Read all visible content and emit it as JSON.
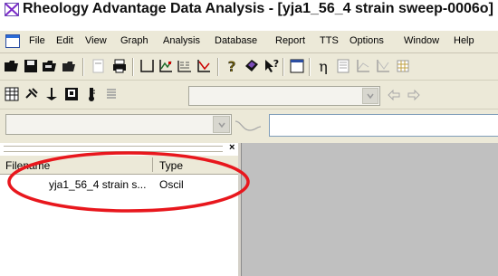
{
  "window": {
    "title": "Rheology Advantage Data Analysis - [yja1_56_4 strain sweep-0006o]"
  },
  "menu": {
    "items": [
      "File",
      "Edit",
      "View",
      "Graph",
      "Analysis",
      "Database",
      "Report",
      "TTS",
      "Options",
      "Window",
      "Help"
    ]
  },
  "toolbar1": {
    "icons": [
      "open-folder-icon",
      "save-icon",
      "open-data-icon",
      "open-file-icon",
      "copy-graph-icon",
      "print-icon",
      "blank-graph-icon",
      "graph-icon",
      "tts-icon",
      "graph-b-icon",
      "help-icon",
      "book-icon",
      "context-help-icon",
      "window-icon",
      "eta-icon",
      "data-table-icon",
      "graph-c-icon",
      "graph-d-icon",
      "grid-icon"
    ]
  },
  "toolbar2": {
    "icons": [
      "table-icon",
      "plug-icon",
      "probe-icon",
      "save-disk-icon",
      "thermometer-icon",
      "list-icon"
    ],
    "combo_value": ""
  },
  "toolbar3": {
    "combo_value": "",
    "input_value": ""
  },
  "file_panel": {
    "columns": [
      "Filename",
      "Type"
    ],
    "rows": [
      {
        "filename": "yja1_56_4 strain s...",
        "type": "Oscil"
      }
    ]
  },
  "colors": {
    "annotation_oval": "#e8171d",
    "toolbar_bg": "#ece9d8",
    "graph_area_bg": "#c0c0c0"
  }
}
